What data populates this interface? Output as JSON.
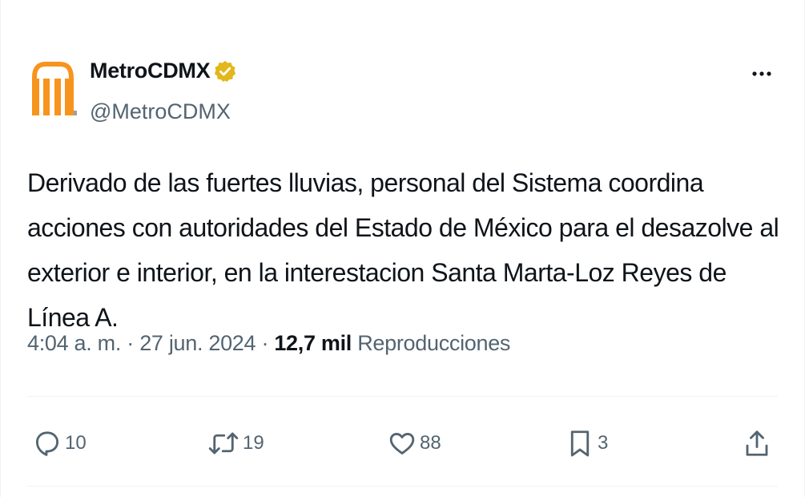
{
  "account": {
    "display_name": "MetroCDMX",
    "handle": "@MetroCDMX",
    "brand_color": "#f7941d",
    "verified_badge_color": "#e2b719"
  },
  "post": {
    "text": "Derivado de las fuertes lluvias, personal del Sistema coordina acciones con autoridades del Estado de México para el desazolve al exterior e interior, en la interestacion Santa Marta-Loz Reyes de Línea A.",
    "time": "4:04 a. m.",
    "separator": "·",
    "date": "27 jun. 2024",
    "views_count": "12,7 mil",
    "views_label": "Reproducciones"
  },
  "actions": {
    "replies": "10",
    "reposts": "19",
    "likes": "88",
    "bookmarks": "3"
  },
  "icons": {
    "more": "more-dots-icon",
    "reply": "reply-bubble-icon",
    "repost": "repost-arrows-icon",
    "like": "heart-icon",
    "bookmark": "bookmark-icon",
    "share": "share-upload-icon",
    "verified": "verified-badge-icon"
  }
}
